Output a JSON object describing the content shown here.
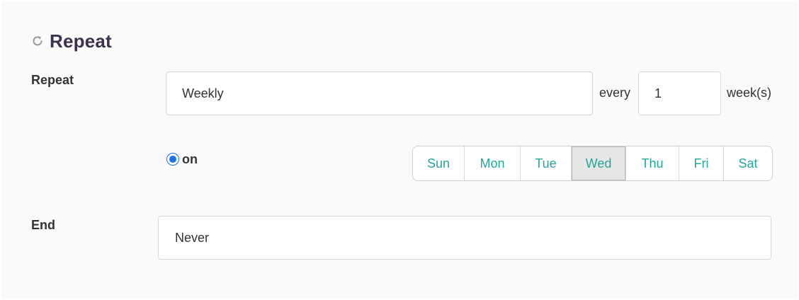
{
  "section": {
    "title": "Repeat",
    "icon": "refresh-icon"
  },
  "repeat_row": {
    "label": "Repeat",
    "frequency_value": "Weekly",
    "every_label": "every",
    "interval_value": "1",
    "unit_label": "week(s)"
  },
  "on_row": {
    "radio_label": "on",
    "radio_checked": true,
    "days": [
      {
        "label": "Sun",
        "selected": false
      },
      {
        "label": "Mon",
        "selected": false
      },
      {
        "label": "Tue",
        "selected": false
      },
      {
        "label": "Wed",
        "selected": true
      },
      {
        "label": "Thu",
        "selected": false
      },
      {
        "label": "Fri",
        "selected": false
      },
      {
        "label": "Sat",
        "selected": false
      }
    ]
  },
  "end_row": {
    "label": "End",
    "value": "Never"
  },
  "colors": {
    "title": "#3d3150",
    "day_text": "#26a69a",
    "radio": "#1a73e8",
    "selected_day_bg": "#e6e6e6"
  }
}
